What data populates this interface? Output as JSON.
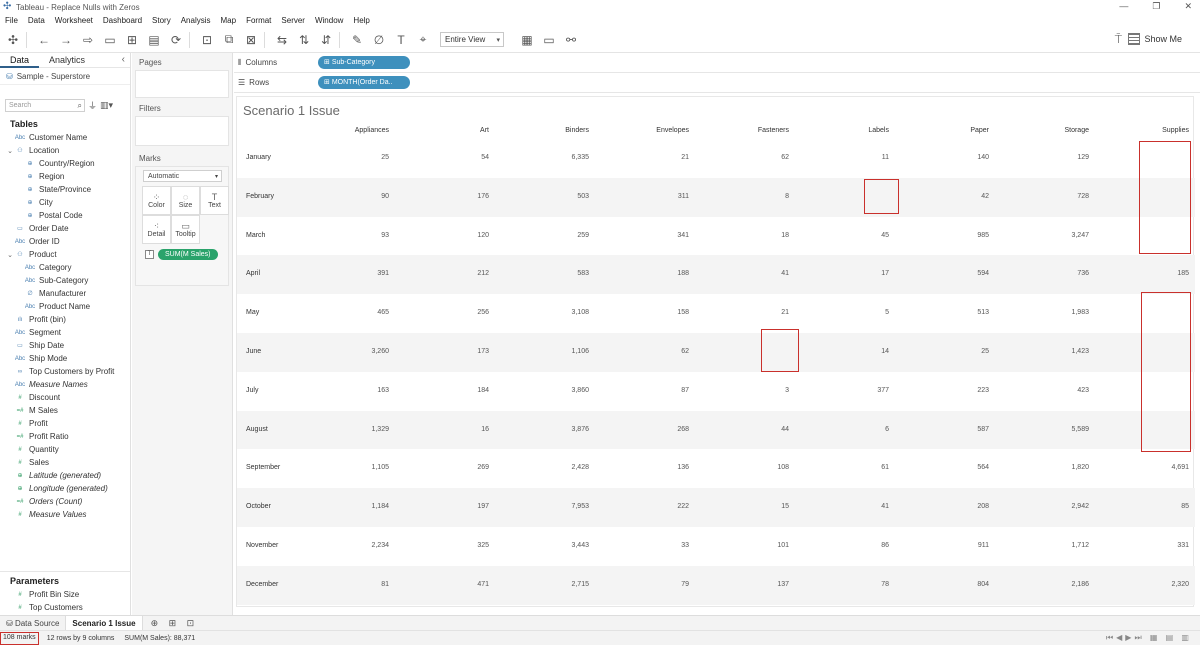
{
  "window": {
    "title": "Tableau - Replace Nulls with Zeros",
    "controls": [
      "—",
      "❐",
      "✕"
    ]
  },
  "menu": [
    "File",
    "Data",
    "Worksheet",
    "Dashboard",
    "Story",
    "Analysis",
    "Map",
    "Format",
    "Server",
    "Window",
    "Help"
  ],
  "toolbar": {
    "fit": "Entire View",
    "show_me": "Show Me"
  },
  "data_pane": {
    "tabs": [
      "Data",
      "Analytics"
    ],
    "datasource": "Sample - Superstore",
    "search_placeholder": "Search",
    "tables_title": "Tables",
    "fields": [
      {
        "label": "Customer Name",
        "icon": "Abc",
        "indent": 0,
        "caret": ""
      },
      {
        "label": "Location",
        "icon": "⚇",
        "indent": 0,
        "caret": "⌄"
      },
      {
        "label": "Country/Region",
        "icon": "⊕",
        "indent": 2,
        "caret": ""
      },
      {
        "label": "Region",
        "icon": "⊕",
        "indent": 2,
        "caret": ""
      },
      {
        "label": "State/Province",
        "icon": "⊕",
        "indent": 2,
        "caret": ""
      },
      {
        "label": "City",
        "icon": "⊕",
        "indent": 2,
        "caret": ""
      },
      {
        "label": "Postal Code",
        "icon": "⊕",
        "indent": 2,
        "caret": ""
      },
      {
        "label": "Order Date",
        "icon": "▭",
        "indent": 0,
        "caret": ""
      },
      {
        "label": "Order ID",
        "icon": "Abc",
        "indent": 0,
        "caret": ""
      },
      {
        "label": "Product",
        "icon": "⚇",
        "indent": 0,
        "caret": "⌄"
      },
      {
        "label": "Category",
        "icon": "Abc",
        "indent": 2,
        "caret": ""
      },
      {
        "label": "Sub-Category",
        "icon": "Abc",
        "indent": 2,
        "caret": ""
      },
      {
        "label": "Manufacturer",
        "icon": "∅",
        "indent": 2,
        "caret": ""
      },
      {
        "label": "Product Name",
        "icon": "Abc",
        "indent": 2,
        "caret": ""
      },
      {
        "label": "Profit (bin)",
        "icon": "ılı",
        "indent": 0,
        "caret": ""
      },
      {
        "label": "Segment",
        "icon": "Abc",
        "indent": 0,
        "caret": ""
      },
      {
        "label": "Ship Date",
        "icon": "▭",
        "indent": 0,
        "caret": ""
      },
      {
        "label": "Ship Mode",
        "icon": "Abc",
        "indent": 0,
        "caret": ""
      },
      {
        "label": "Top Customers by Profit",
        "icon": "∞",
        "indent": 0,
        "caret": ""
      },
      {
        "label": "Measure Names",
        "icon": "Abc",
        "indent": 0,
        "caret": "",
        "italic": true
      },
      {
        "label": "Discount",
        "icon": "#",
        "indent": 0,
        "caret": "",
        "green": true
      },
      {
        "label": "M Sales",
        "icon": "=#",
        "indent": 0,
        "caret": "",
        "green": true
      },
      {
        "label": "Profit",
        "icon": "#",
        "indent": 0,
        "caret": "",
        "green": true
      },
      {
        "label": "Profit Ratio",
        "icon": "=#",
        "indent": 0,
        "caret": "",
        "green": true
      },
      {
        "label": "Quantity",
        "icon": "#",
        "indent": 0,
        "caret": "",
        "green": true
      },
      {
        "label": "Sales",
        "icon": "#",
        "indent": 0,
        "caret": "",
        "green": true
      },
      {
        "label": "Latitude (generated)",
        "icon": "⊕",
        "indent": 0,
        "caret": "",
        "green": true,
        "italic": true
      },
      {
        "label": "Longitude (generated)",
        "icon": "⊕",
        "indent": 0,
        "caret": "",
        "green": true,
        "italic": true
      },
      {
        "label": "Orders (Count)",
        "icon": "=#",
        "indent": 0,
        "caret": "",
        "green": true,
        "italic": true
      },
      {
        "label": "Measure Values",
        "icon": "#",
        "indent": 0,
        "caret": "",
        "green": true,
        "italic": true
      }
    ],
    "parameters_title": "Parameters",
    "parameters": [
      {
        "label": "Profit Bin Size",
        "icon": "#"
      },
      {
        "label": "Top Customers",
        "icon": "#"
      }
    ]
  },
  "cards": {
    "pages": "Pages",
    "filters": "Filters",
    "marks": "Marks",
    "mark_type": "Automatic",
    "mark_buttons": [
      {
        "label": "Color",
        "icon": "⁘"
      },
      {
        "label": "Size",
        "icon": "◌"
      },
      {
        "label": "Text",
        "icon": "T"
      },
      {
        "label": "Detail",
        "icon": "⁖"
      },
      {
        "label": "Tooltip",
        "icon": "▭"
      }
    ],
    "measure_pill": "SUM(M Sales)"
  },
  "shelves": {
    "columns_label": "Columns",
    "columns_pill": "Sub-Category",
    "rows_label": "Rows",
    "rows_pill": "MONTH(Order Da.."
  },
  "viz": {
    "title": "Scenario 1 Issue",
    "columns": [
      "Appliances",
      "Art",
      "Binders",
      "Envelopes",
      "Fasteners",
      "Labels",
      "Paper",
      "Storage",
      "Supplies"
    ],
    "rows": [
      {
        "label": "January",
        "values": [
          "25",
          "54",
          "6,335",
          "21",
          "62",
          "11",
          "140",
          "129",
          ""
        ]
      },
      {
        "label": "February",
        "values": [
          "90",
          "176",
          "503",
          "311",
          "8",
          "",
          "42",
          "728",
          ""
        ]
      },
      {
        "label": "March",
        "values": [
          "93",
          "120",
          "259",
          "341",
          "18",
          "45",
          "985",
          "3,247",
          ""
        ]
      },
      {
        "label": "April",
        "values": [
          "391",
          "212",
          "583",
          "188",
          "41",
          "17",
          "594",
          "736",
          "185"
        ]
      },
      {
        "label": "May",
        "values": [
          "465",
          "256",
          "3,108",
          "158",
          "21",
          "5",
          "513",
          "1,983",
          ""
        ]
      },
      {
        "label": "June",
        "values": [
          "3,260",
          "173",
          "1,106",
          "62",
          "",
          "14",
          "25",
          "1,423",
          ""
        ]
      },
      {
        "label": "July",
        "values": [
          "163",
          "184",
          "3,860",
          "87",
          "3",
          "377",
          "223",
          "423",
          ""
        ]
      },
      {
        "label": "August",
        "values": [
          "1,329",
          "16",
          "3,876",
          "268",
          "44",
          "6",
          "587",
          "5,589",
          ""
        ]
      },
      {
        "label": "September",
        "values": [
          "1,105",
          "269",
          "2,428",
          "136",
          "108",
          "61",
          "564",
          "1,820",
          "4,691"
        ]
      },
      {
        "label": "October",
        "values": [
          "1,184",
          "197",
          "7,953",
          "222",
          "15",
          "41",
          "208",
          "2,942",
          "85"
        ]
      },
      {
        "label": "November",
        "values": [
          "2,234",
          "325",
          "3,443",
          "33",
          "101",
          "86",
          "911",
          "1,712",
          "331"
        ]
      },
      {
        "label": "December",
        "values": [
          "81",
          "471",
          "2,715",
          "79",
          "137",
          "78",
          "804",
          "2,186",
          "2,320"
        ]
      }
    ]
  },
  "sheet_tabs": {
    "data_source": "Data Source",
    "active": "Scenario 1 Issue"
  },
  "status": {
    "marks": "108 marks",
    "dims": "12 rows by 9 columns",
    "sum": "SUM(M Sales): 88,371"
  },
  "colors": {
    "highlight": "#c9302c",
    "blue_pill": "#3e90bd",
    "green_pill": "#2aa36b"
  }
}
